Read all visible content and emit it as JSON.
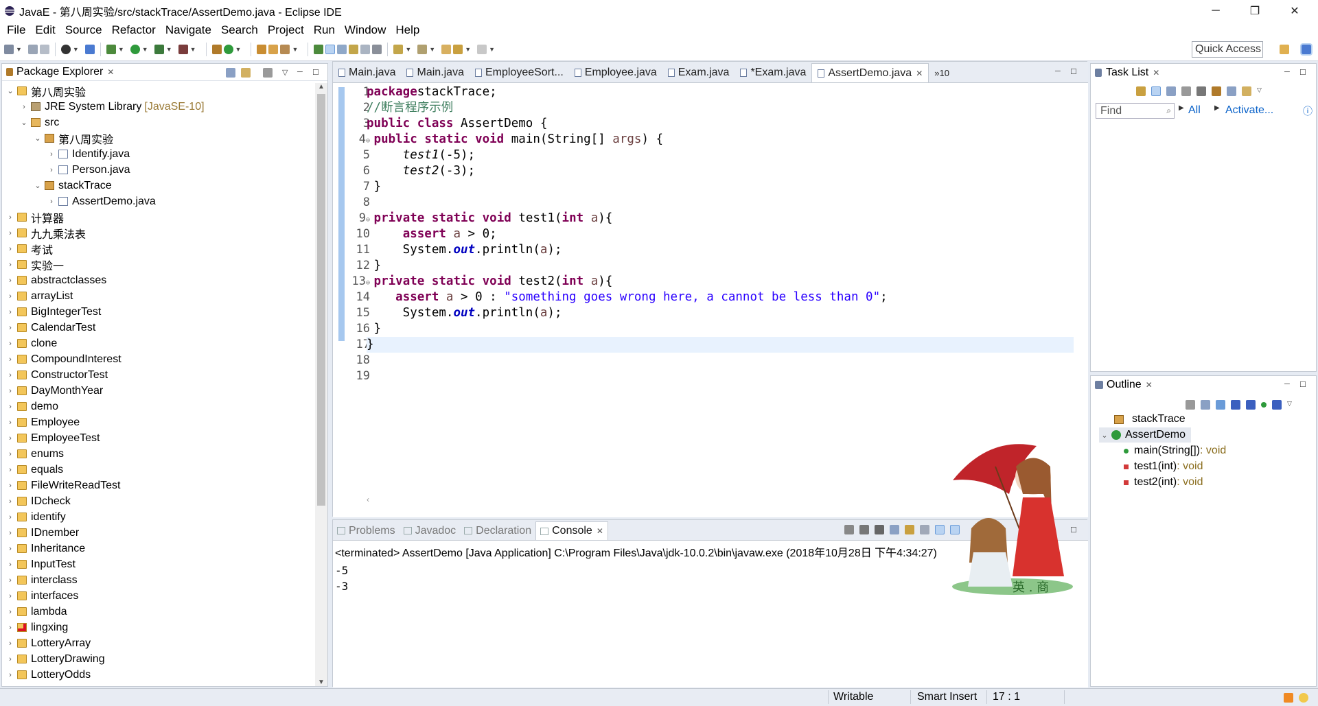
{
  "window": {
    "title": "JavaE - 第八周实验/src/stackTrace/AssertDemo.java - Eclipse IDE",
    "minimize": "─",
    "maximize": "❐",
    "close": "✕"
  },
  "menu": [
    "File",
    "Edit",
    "Source",
    "Refactor",
    "Navigate",
    "Search",
    "Project",
    "Run",
    "Window",
    "Help"
  ],
  "toolbar": {
    "quick_access": "Quick Access"
  },
  "package_explorer": {
    "title": "Package Explorer",
    "rows": [
      {
        "indent": 0,
        "tw": "⌄",
        "icon": "proj",
        "label": "第八周实验",
        "suffix": ""
      },
      {
        "indent": 1,
        "tw": "›",
        "icon": "lib",
        "label": "JRE System Library",
        "suffix": "[JavaSE-10]"
      },
      {
        "indent": 1,
        "tw": "⌄",
        "icon": "src",
        "label": "src",
        "suffix": ""
      },
      {
        "indent": 2,
        "tw": "⌄",
        "icon": "pkg",
        "label": "第八周实验",
        "suffix": ""
      },
      {
        "indent": 3,
        "tw": "›",
        "icon": "jf",
        "label": "Identify.java",
        "suffix": ""
      },
      {
        "indent": 3,
        "tw": "›",
        "icon": "jf",
        "label": "Person.java",
        "suffix": ""
      },
      {
        "indent": 2,
        "tw": "⌄",
        "icon": "pkg",
        "label": "stackTrace",
        "suffix": ""
      },
      {
        "indent": 3,
        "tw": "›",
        "icon": "jf",
        "label": "AssertDemo.java",
        "suffix": ""
      },
      {
        "indent": 0,
        "tw": "›",
        "icon": "proj",
        "label": "计算器",
        "suffix": ""
      },
      {
        "indent": 0,
        "tw": "›",
        "icon": "proj",
        "label": "九九乘法表",
        "suffix": ""
      },
      {
        "indent": 0,
        "tw": "›",
        "icon": "proj",
        "label": "考试",
        "suffix": ""
      },
      {
        "indent": 0,
        "tw": "›",
        "icon": "proj",
        "label": "实验一",
        "suffix": ""
      },
      {
        "indent": 0,
        "tw": "›",
        "icon": "proj",
        "label": "abstractclasses",
        "suffix": ""
      },
      {
        "indent": 0,
        "tw": "›",
        "icon": "proj",
        "label": "arrayList",
        "suffix": ""
      },
      {
        "indent": 0,
        "tw": "›",
        "icon": "proj",
        "label": "BigIntegerTest",
        "suffix": ""
      },
      {
        "indent": 0,
        "tw": "›",
        "icon": "proj",
        "label": "CalendarTest",
        "suffix": ""
      },
      {
        "indent": 0,
        "tw": "›",
        "icon": "proj",
        "label": "clone",
        "suffix": ""
      },
      {
        "indent": 0,
        "tw": "›",
        "icon": "proj",
        "label": "CompoundInterest",
        "suffix": ""
      },
      {
        "indent": 0,
        "tw": "›",
        "icon": "proj",
        "label": "ConstructorTest",
        "suffix": ""
      },
      {
        "indent": 0,
        "tw": "›",
        "icon": "proj",
        "label": "DayMonthYear",
        "suffix": ""
      },
      {
        "indent": 0,
        "tw": "›",
        "icon": "proj",
        "label": "demo",
        "suffix": ""
      },
      {
        "indent": 0,
        "tw": "›",
        "icon": "proj",
        "label": "Employee",
        "suffix": ""
      },
      {
        "indent": 0,
        "tw": "›",
        "icon": "proj",
        "label": "EmployeeTest",
        "suffix": ""
      },
      {
        "indent": 0,
        "tw": "›",
        "icon": "proj",
        "label": "enums",
        "suffix": ""
      },
      {
        "indent": 0,
        "tw": "›",
        "icon": "proj",
        "label": "equals",
        "suffix": ""
      },
      {
        "indent": 0,
        "tw": "›",
        "icon": "proj",
        "label": "FileWriteReadTest",
        "suffix": ""
      },
      {
        "indent": 0,
        "tw": "›",
        "icon": "proj",
        "label": "IDcheck",
        "suffix": ""
      },
      {
        "indent": 0,
        "tw": "›",
        "icon": "proj",
        "label": "identify",
        "suffix": ""
      },
      {
        "indent": 0,
        "tw": "›",
        "icon": "proj",
        "label": "IDnember",
        "suffix": ""
      },
      {
        "indent": 0,
        "tw": "›",
        "icon": "proj",
        "label": "Inheritance",
        "suffix": ""
      },
      {
        "indent": 0,
        "tw": "›",
        "icon": "proj",
        "label": "InputTest",
        "suffix": ""
      },
      {
        "indent": 0,
        "tw": "›",
        "icon": "proj",
        "label": "interclass",
        "suffix": ""
      },
      {
        "indent": 0,
        "tw": "›",
        "icon": "proj",
        "label": "interfaces",
        "suffix": ""
      },
      {
        "indent": 0,
        "tw": "›",
        "icon": "proj",
        "label": "lambda",
        "suffix": ""
      },
      {
        "indent": 0,
        "tw": "›",
        "icon": "err",
        "label": "lingxing",
        "suffix": ""
      },
      {
        "indent": 0,
        "tw": "›",
        "icon": "proj",
        "label": "LotteryArray",
        "suffix": ""
      },
      {
        "indent": 0,
        "tw": "›",
        "icon": "proj",
        "label": "LotteryDrawing",
        "suffix": ""
      },
      {
        "indent": 0,
        "tw": "›",
        "icon": "proj",
        "label": "LotteryOdds",
        "suffix": ""
      }
    ]
  },
  "editor": {
    "tabs": [
      "Main.java",
      "Main.java",
      "EmployeeSort...",
      "Employee.java",
      "Exam.java",
      "*Exam.java",
      "AssertDemo.java"
    ],
    "active_tab": 6,
    "overflow": "»10",
    "line_numbers": [
      "1",
      "2",
      "3",
      "4",
      "5",
      "6",
      "7",
      "8",
      "9",
      "10",
      "11",
      "12",
      "13",
      "14",
      "15",
      "16",
      "17",
      "18",
      "19"
    ],
    "fold_marks": {
      "4": "⊖",
      "9": "⊖",
      "13": "⊖"
    },
    "current_line": 17,
    "code": [
      [
        [
          "kw",
          "package"
        ],
        [
          "",
          "stackTrace;"
        ]
      ],
      [
        [
          "cm",
          "//断言程序示例"
        ]
      ],
      [
        [
          "kw",
          "public"
        ],
        [
          "",
          " "
        ],
        [
          "kw",
          "class"
        ],
        [
          "",
          " AssertDemo {"
        ]
      ],
      [
        [
          "",
          " "
        ],
        [
          "kw",
          "public"
        ],
        [
          "",
          " "
        ],
        [
          "kw",
          "static"
        ],
        [
          "",
          " "
        ],
        [
          "kw",
          "void"
        ],
        [
          "",
          " main(String[] "
        ],
        [
          "pv",
          "args"
        ],
        [
          "",
          ") {"
        ]
      ],
      [
        [
          "",
          "     "
        ],
        [
          "sm",
          "test1"
        ],
        [
          "",
          "(-5);"
        ]
      ],
      [
        [
          "",
          "     "
        ],
        [
          "sm",
          "test2"
        ],
        [
          "",
          "(-3);"
        ]
      ],
      [
        [
          "",
          " }"
        ]
      ],
      [
        [
          "",
          " "
        ]
      ],
      [
        [
          "",
          " "
        ],
        [
          "kw",
          "private"
        ],
        [
          "",
          " "
        ],
        [
          "kw",
          "static"
        ],
        [
          "",
          " "
        ],
        [
          "kw",
          "void"
        ],
        [
          "",
          " test1("
        ],
        [
          "kw",
          "int"
        ],
        [
          "",
          " "
        ],
        [
          "pv",
          "a"
        ],
        [
          "",
          "){"
        ]
      ],
      [
        [
          "",
          "     "
        ],
        [
          "kw",
          "assert"
        ],
        [
          "",
          " "
        ],
        [
          "pv",
          "a"
        ],
        [
          "",
          " > 0;"
        ]
      ],
      [
        [
          "",
          "     System."
        ],
        [
          "fd",
          "out"
        ],
        [
          "",
          ".println("
        ],
        [
          "pv",
          "a"
        ],
        [
          "",
          ");"
        ]
      ],
      [
        [
          "",
          " }"
        ]
      ],
      [
        [
          "",
          " "
        ],
        [
          "kw",
          "private"
        ],
        [
          "",
          " "
        ],
        [
          "kw",
          "static"
        ],
        [
          "",
          " "
        ],
        [
          "kw",
          "void"
        ],
        [
          "",
          " test2("
        ],
        [
          "kw",
          "int"
        ],
        [
          "",
          " "
        ],
        [
          "pv",
          "a"
        ],
        [
          "",
          "){"
        ]
      ],
      [
        [
          "",
          "    "
        ],
        [
          "kw",
          "assert"
        ],
        [
          "",
          " "
        ],
        [
          "pv",
          "a"
        ],
        [
          "",
          " > 0 : "
        ],
        [
          "st",
          "\"something goes wrong here, a cannot be less than 0\""
        ],
        [
          "",
          ";"
        ]
      ],
      [
        [
          "",
          "     System."
        ],
        [
          "fd",
          "out"
        ],
        [
          "",
          ".println("
        ],
        [
          "pv",
          "a"
        ],
        [
          "",
          ");"
        ]
      ],
      [
        [
          "",
          " }"
        ]
      ],
      [
        [
          "",
          "}"
        ]
      ],
      [
        [
          "",
          ""
        ]
      ],
      [
        [
          "",
          ""
        ]
      ]
    ]
  },
  "console": {
    "tabs": [
      "Problems",
      "Javadoc",
      "Declaration",
      "Console"
    ],
    "active_tab": 3,
    "terminated": "<terminated> AssertDemo [Java Application] C:\\Program Files\\Java\\jdk-10.0.2\\bin\\javaw.exe (2018年10月28日 下午4:34:27)",
    "output": [
      "-5",
      "-3"
    ]
  },
  "task_list": {
    "title": "Task List",
    "find_placeholder": "Find",
    "all_link": "All",
    "activate_link": "Activate..."
  },
  "outline": {
    "title": "Outline",
    "package": "stackTrace",
    "class": "AssertDemo",
    "methods": [
      {
        "name": "main(String[])",
        "ret": " : void",
        "vis": "public",
        "color": "#2e9a3b"
      },
      {
        "name": "test1(int)",
        "ret": " : void",
        "vis": "private",
        "color": "#d23a3a"
      },
      {
        "name": "test2(int)",
        "ret": " : void",
        "vis": "private",
        "color": "#d23a3a"
      }
    ]
  },
  "status": {
    "writable": "Writable",
    "insert_mode": "Smart Insert",
    "position": "17 : 1"
  },
  "watermark_text": "英 . 商",
  "colors": {
    "keyword": "#7f0055",
    "comment": "#3f7f5f",
    "string": "#2a00ff",
    "field": "#0000c0",
    "current_line": "#e8f2fe"
  }
}
